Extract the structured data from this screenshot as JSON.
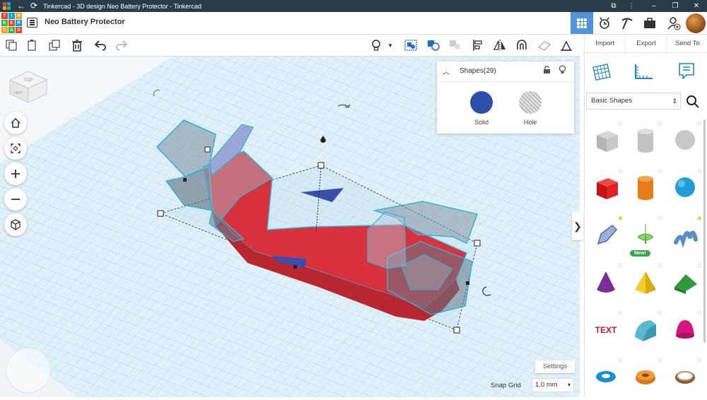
{
  "window": {
    "title": "Tinkercad - 3D design Neo Battery Protector - Tinkercad"
  },
  "logo": {
    "letters": [
      "T",
      "I",
      "N",
      "K",
      "E",
      "R",
      "C",
      "A",
      "D"
    ],
    "colors": [
      "#e8452c",
      "#00a8e0",
      "#f7a21b",
      "#3ab54a",
      "#e8452c",
      "#00a8e0",
      "#f7a21b",
      "#3ab54a",
      "#e8452c"
    ]
  },
  "header": {
    "design_title": "Neo Battery Protector"
  },
  "shapes_panel": {
    "title": "Shapes(29)",
    "solid_label": "Solid",
    "hole_label": "Hole",
    "solid_color": "#2e4fa8"
  },
  "viewport": {
    "cube_top": "TOP",
    "cube_left": "LEFT",
    "settings_label": "Settings",
    "snap_grid_label": "Snap Grid",
    "snap_grid_value": "1.0 mm"
  },
  "right_panel": {
    "tabs": {
      "import": "Import",
      "export": "Export",
      "send_to": "Send To"
    },
    "library": "Basic Shapes",
    "shapes": [
      {
        "name": "box-hole",
        "star": "grey"
      },
      {
        "name": "cylinder-hole",
        "star": "grey"
      },
      {
        "name": "sphere-hole",
        "star": "grey"
      },
      {
        "name": "box",
        "star": "grey"
      },
      {
        "name": "cylinder",
        "star": "grey"
      },
      {
        "name": "sphere",
        "star": "grey"
      },
      {
        "name": "scribble",
        "star": "gold"
      },
      {
        "name": "shape-generator",
        "star": "grey",
        "badge": "New!"
      },
      {
        "name": "text-squiggle",
        "star": "gold"
      },
      {
        "name": "cone",
        "star": "grey"
      },
      {
        "name": "pyramid",
        "star": "grey"
      },
      {
        "name": "roof",
        "star": "grey"
      },
      {
        "name": "text",
        "star": "grey"
      },
      {
        "name": "half-cylinder",
        "star": "grey"
      },
      {
        "name": "paraboloid",
        "star": "grey"
      },
      {
        "name": "torus",
        "star": "grey"
      },
      {
        "name": "tube",
        "star": "grey"
      },
      {
        "name": "ring",
        "star": "grey"
      }
    ],
    "text_shape_word": "TEXT"
  }
}
